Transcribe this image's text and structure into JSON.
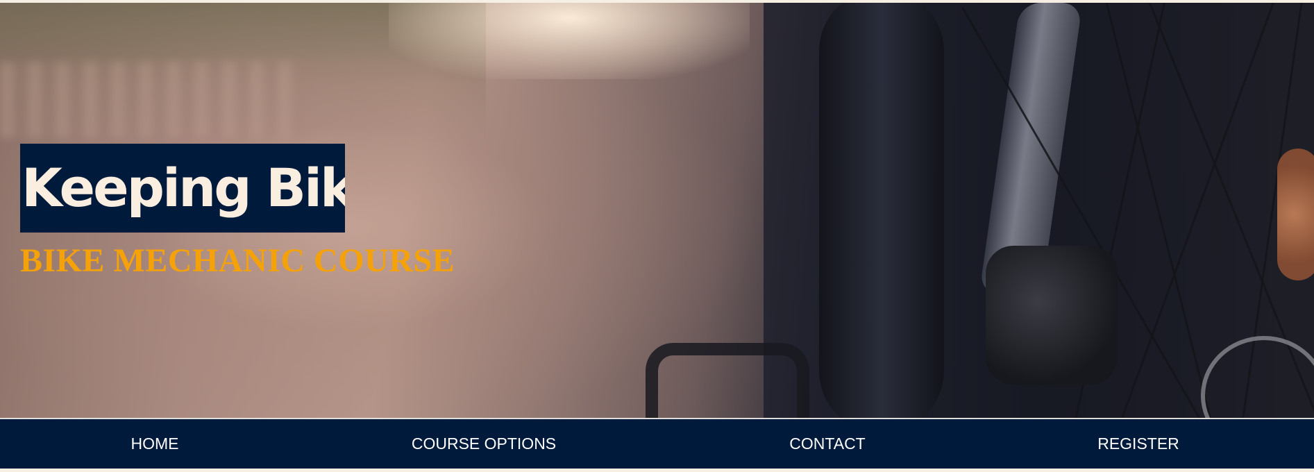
{
  "hero": {
    "title": "Keeping Bike",
    "subtitle": "BIKE MECHANIC COURSE",
    "image": "bicycle-wheel-photo"
  },
  "nav": {
    "items": [
      {
        "label": "HOME"
      },
      {
        "label": "COURSE OPTIONS"
      },
      {
        "label": "CONTACT"
      },
      {
        "label": "REGISTER"
      }
    ]
  },
  "colors": {
    "navy": "#001a3c",
    "title_text": "#faeee0",
    "subtitle_text": "#f5a20a",
    "page_background": "#f6efe4"
  }
}
